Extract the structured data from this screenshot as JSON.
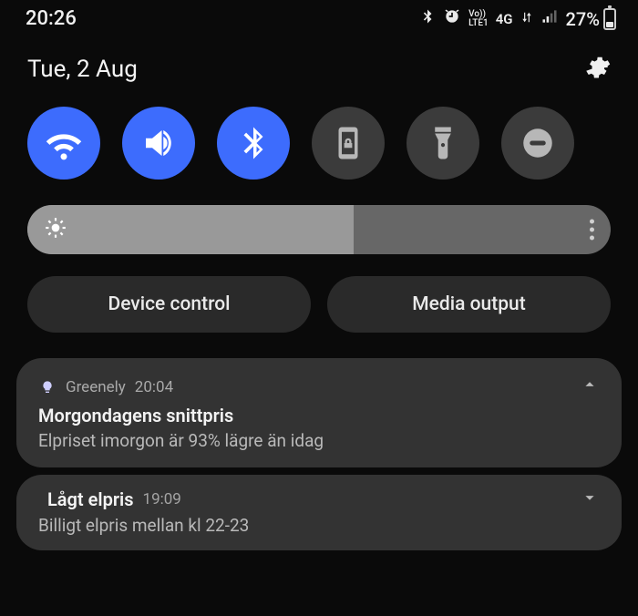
{
  "status": {
    "time": "20:26",
    "battery_pct": "27%",
    "network": "4G",
    "lte_line1": "Vo))",
    "lte_line2": "LTE1"
  },
  "header": {
    "date": "Tue, 2 Aug"
  },
  "quick_settings": {
    "wifi": {
      "name": "wifi",
      "on": true
    },
    "sound": {
      "name": "sound",
      "on": true
    },
    "bluetooth": {
      "name": "bluetooth",
      "on": true
    },
    "rotation": {
      "name": "portrait-lock",
      "on": false
    },
    "flashlight": {
      "name": "flashlight",
      "on": false
    },
    "dnd": {
      "name": "do-not-disturb",
      "on": false
    }
  },
  "brightness": {
    "percent": 56
  },
  "pills": {
    "device_control": "Device control",
    "media_output": "Media output"
  },
  "notifications": [
    {
      "app": "Greenely",
      "time": "20:04",
      "title": "Morgondagens snittpris",
      "body": "Elpriset imorgon är 93% lägre än idag",
      "expanded": true
    },
    {
      "app_icon_only": true,
      "title": "Lågt elpris",
      "time": "19:09",
      "body": "Billigt elpris mellan kl 22-23",
      "expanded": false
    }
  ]
}
